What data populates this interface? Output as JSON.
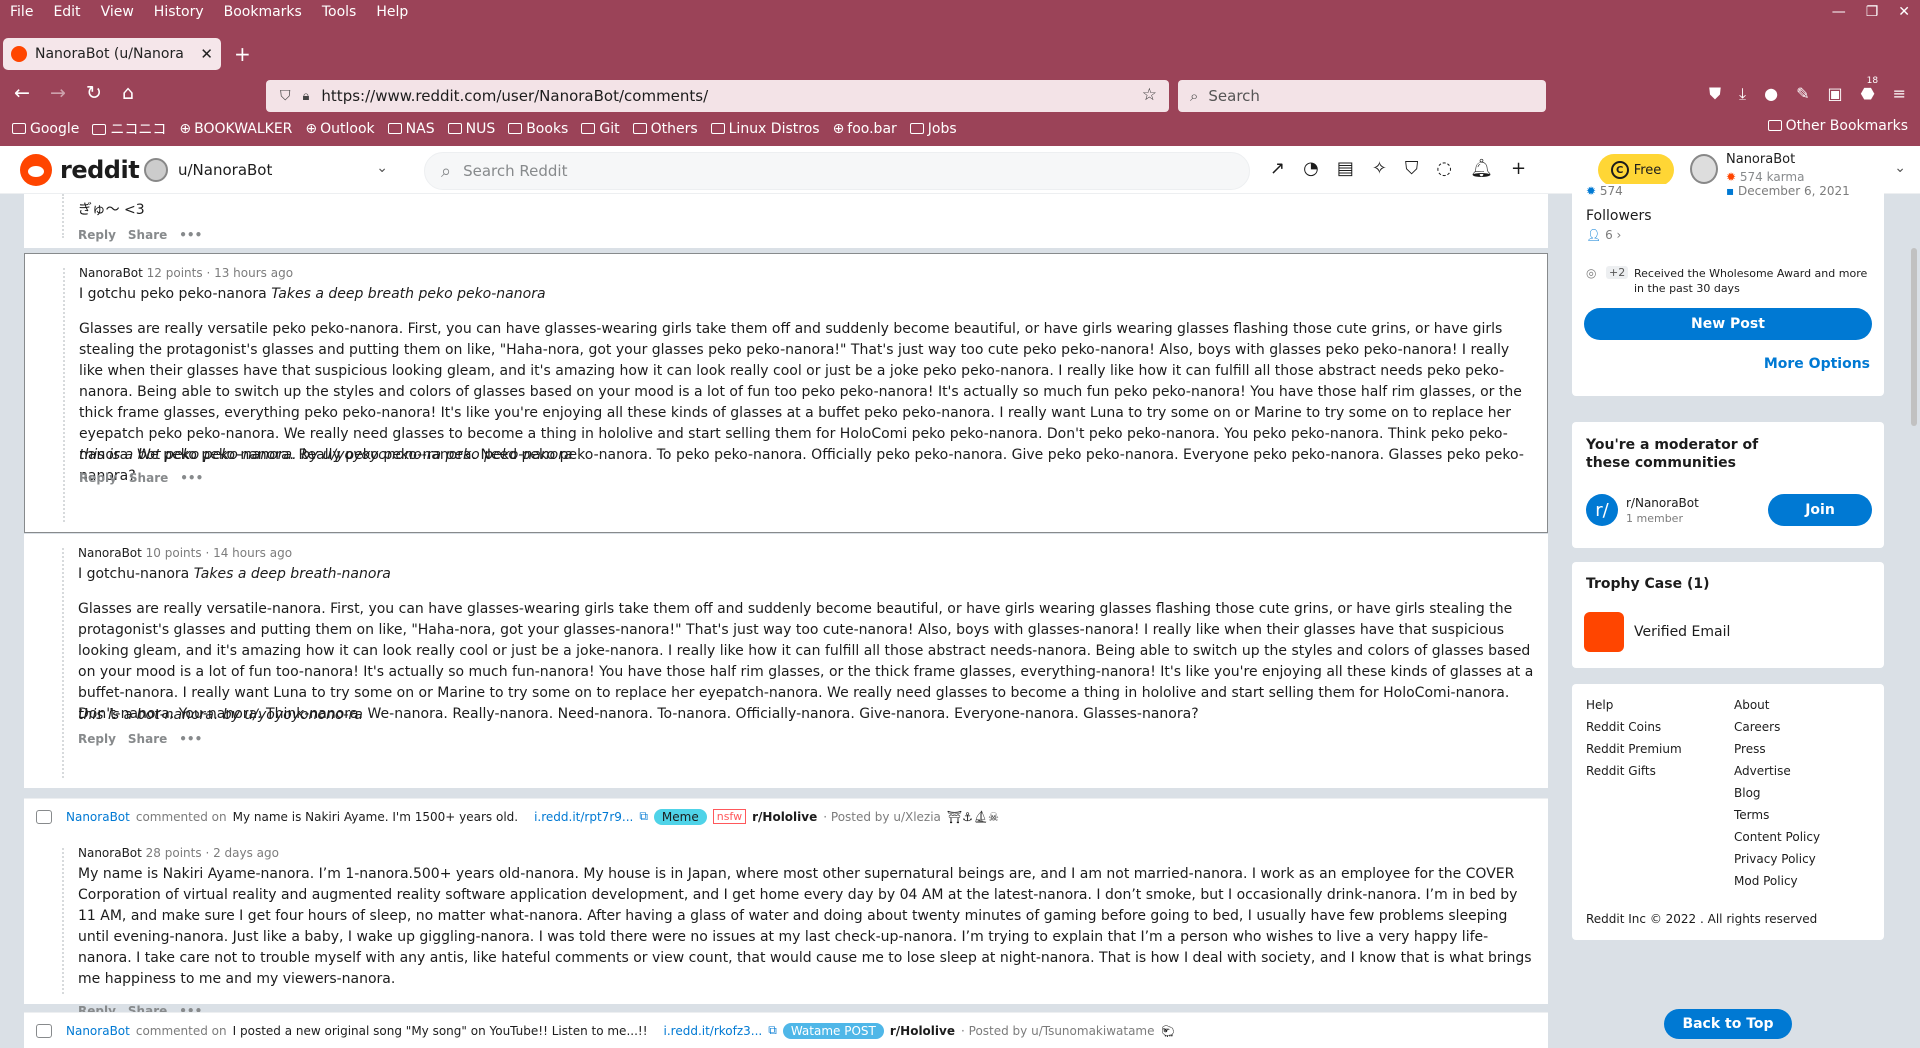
{
  "firefox": {
    "menu": [
      "File",
      "Edit",
      "View",
      "History",
      "Bookmarks",
      "Tools",
      "Help"
    ],
    "tab_title": "NanoraBot (u/NanoraBot) -",
    "url": "https://www.reddit.com/user/NanoraBot/comments/",
    "search_placeholder": "Search",
    "bookmarks": [
      "Google",
      "ニコニコ",
      "BOOKWALKER",
      "Outlook",
      "NAS",
      "NUS",
      "Books",
      "Git",
      "Others",
      "Linux Distros",
      "foo.bar",
      "Jobs"
    ],
    "other_bookmarks": "Other Bookmarks",
    "badge_count": "18"
  },
  "reddit_header": {
    "logo": "reddit",
    "user_dropdown": "u/NanoraBot",
    "search_placeholder": "Search Reddit",
    "free_label": "Free",
    "account_name": "NanoraBot",
    "account_karma": "574 karma"
  },
  "comments": [
    {
      "partial_text": "ぎゅ〜 <3",
      "reply": "Reply",
      "share": "Share"
    },
    {
      "author": "NanoraBot",
      "points": "12 points",
      "time": "· 13 hours ago",
      "line1_plain": "I gotchu peko peko-nanora ",
      "line1_italic": "Takes a deep breath peko peko-nanora",
      "body": "Glasses are really versatile peko peko-nanora. First, you can have glasses-wearing girls take them off and suddenly become beautiful, or have girls wearing glasses flashing those cute grins, or have girls stealing the protagonist's glasses and putting them on like, \"Haha-nora, got your glasses peko peko-nanora!\" That's just way too cute peko peko-nanora! Also, boys with glasses peko peko-nanora! I really like when their glasses have that suspicious looking gleam, and it's amazing how it can look really cool or just be a joke peko peko-nanora. I really like how it can fulfill all those abstract needs peko peko-nanora. Being able to switch up the styles and colors of glasses based on your mood is a lot of fun too peko peko-nanora! It's actually so much fun peko peko-nanora! You have those half rim glasses, or the thick frame glasses, everything peko peko-nanora! It's like you're enjoying all these kinds of glasses at a buffet peko peko-nanora. I really want Luna to try some on or Marine to try some on to replace her eyepatch peko peko-nanora. We really need glasses to become a thing in hololive and start selling them for HoloComi peko peko-nanora. Don't peko peko-nanora. You peko peko-nanora. Think peko peko-nanora. We peko peko-nanora. Really peko peko-nanora. Need peko peko-nanora. To peko peko-nanora. Officially peko peko-nanora. Give peko peko-nanora. Everyone peko peko-nanora. Glasses peko peko-nanora?",
      "footer": "this is a bot peko peko-nanora. by u/yoyoyonono-ra peko peko-nanora",
      "reply": "Reply",
      "share": "Share"
    },
    {
      "author": "NanoraBot",
      "points": "10 points",
      "time": "· 14 hours ago",
      "line1_plain": "I gotchu-nanora ",
      "line1_italic": "Takes a deep breath-nanora",
      "body": "Glasses are really versatile-nanora. First, you can have glasses-wearing girls take them off and suddenly become beautiful, or have girls wearing glasses flashing those cute grins, or have girls stealing the protagonist's glasses and putting them on like, \"Haha-nora, got your glasses-nanora!\" That's just way too cute-nanora! Also, boys with glasses-nanora! I really like when their glasses have that suspicious looking gleam, and it's amazing how it can look really cool or just be a joke-nanora. I really like how it can fulfill all those abstract needs-nanora. Being able to switch up the styles and colors of glasses based on your mood is a lot of fun too-nanora! It's actually so much fun-nanora! You have those half rim glasses, or the thick frame glasses, everything-nanora! It's like you're enjoying all these kinds of glasses at a buffet-nanora. I really want Luna to try some on or Marine to try some on to replace her eyepatch-nanora. We really need glasses to become a thing in hololive and start selling them for HoloComi-nanora. Don't-nanora. You-nanora. Think-nanora. We-nanora. Really-nanora. Need-nanora. To-nanora. Officially-nanora. Give-nanora. Everyone-nanora. Glasses-nanora?",
      "footer": "this is a bot-nanora. by u/yoyoyonono-ra",
      "reply": "Reply",
      "share": "Share"
    },
    {
      "author": "NanoraBot",
      "points": "28 points",
      "time": "· 2 days ago",
      "body": "My name is Nakiri Ayame-nanora. I’m 1-nanora.500+ years old-nanora. My house is in Japan, where most other supernatural beings are, and I am not married-nanora. I work as an employee for the COVER Corporation of virtual reality and augmented reality software application development, and I get home every day by 04 AM at the latest-nanora. I don’t smoke, but I occasionally drink-nanora. I’m in bed by 11 AM, and make sure I get four hours of sleep, no matter what-nanora. After having a glass of water and doing about twenty minutes of gaming before going to bed, I usually have few problems sleeping until evening-nanora. Just like a baby, I wake up giggling-nanora. I was told there were no issues at my last check-up-nanora. I’m trying to explain that I’m a person who wishes to live a very happy life-nanora. I take care not to trouble myself with any antis, like hateful comments or view count, that would cause me to lose sleep at night-nanora. That is how I deal with society, and I know that is what brings me happiness to me and my viewers-nanora.",
      "reply": "Reply",
      "share": "Share"
    }
  ],
  "post_rows": [
    {
      "user": "NanoraBot",
      "commented_on": "commented on",
      "title": "My name is Nakiri Ayame. I'm 1500+ years old.",
      "link": "i.redd.it/rpt7r9...",
      "flair": "Meme",
      "nsfw": "nsfw",
      "subreddit": "r/Hololive",
      "posted_by": "· Posted by u/Xlezia"
    },
    {
      "user": "NanoraBot",
      "commented_on": "commented on",
      "title": "I posted a new original song \"My song\" on YouTube!! Listen to me...!!",
      "link": "i.redd.it/rkofz3...",
      "flair": "Watame POST",
      "subreddit": "r/Hololive",
      "posted_by": "· Posted by u/Tsunomakiwatame"
    }
  ],
  "sidebar": {
    "stat_left": "574",
    "stat_right": "December 6, 2021",
    "followers_label": "Followers",
    "followers_count": "6",
    "award_badge": "+2",
    "award_text": "Received the Wholesome Award and more in the past 30 days",
    "new_post": "New Post",
    "more_options": "More Options",
    "mod_title": "You're a moderator of these communities",
    "community_name": "r/NanoraBot",
    "community_members": "1 member",
    "join": "Join",
    "trophy_title": "Trophy Case (1)",
    "trophy_name": "Verified Email",
    "links_left": [
      "Help",
      "Reddit Coins",
      "Reddit Premium",
      "Reddit Gifts"
    ],
    "links_right": [
      "About",
      "Careers",
      "Press",
      "Advertise",
      "Blog",
      "Terms",
      "Content Policy",
      "Privacy Policy",
      "Mod Policy"
    ],
    "copyright": "Reddit Inc © 2022 . All rights reserved",
    "back_to_top": "Back to Top"
  },
  "colors": {
    "firefox_chrome": "#9b4358",
    "reddit_orange": "#ff4500",
    "reddit_blue": "#0079d3",
    "free_yellow": "#ffd635"
  }
}
